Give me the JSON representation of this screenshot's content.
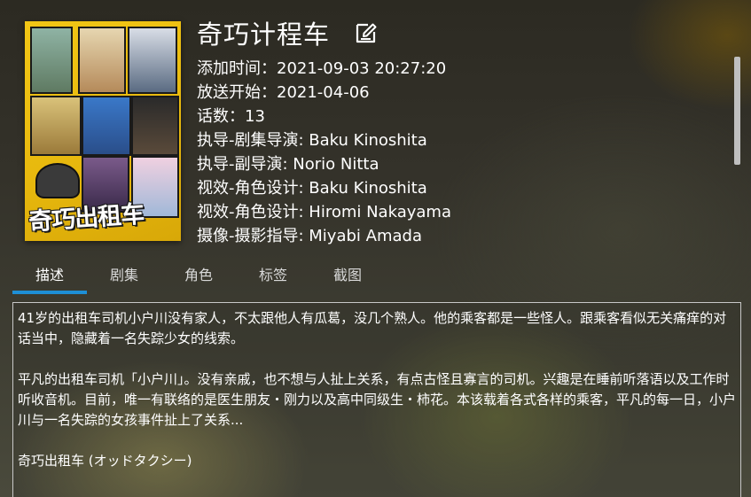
{
  "poster": {
    "logo_text": "奇巧出租车"
  },
  "header": {
    "title": "奇巧计程车",
    "edit_icon": "edit-icon"
  },
  "details": [
    "添加时间：2021-09-03 20:27:20",
    "放送开始：2021-04-06",
    "话数：13",
    "执导-剧集导演: Baku Kinoshita",
    "执导-副导演: Norio Nitta",
    "视效-角色设计: Baku Kinoshita",
    "视效-角色设计: Hiromi Nakayama",
    "摄像-摄影指导: Miyabi Amada"
  ],
  "tabs": [
    {
      "label": "描述",
      "active": true
    },
    {
      "label": "剧集",
      "active": false
    },
    {
      "label": "角色",
      "active": false
    },
    {
      "label": "标签",
      "active": false
    },
    {
      "label": "截图",
      "active": false
    }
  ],
  "description": [
    "41岁的出租车司机小户川没有家人，不太跟他人有瓜葛，没几个熟人。他的乘客都是一些怪人。跟乘客看似无关痛痒的对话当中，隐藏着一名失踪少女的线索。",
    "平凡的出租车司机「小户川」。没有亲戚，也不想与人扯上关系，有点古怪且寡言的司机。兴趣是在睡前听落语以及工作时听收音机。目前，唯一有联络的是医生朋友・刚力以及高中同级生・柿花。本该载着各式各样的乘客，平凡的每一日，小户川与一名失踪的女孩事件扯上了关系...",
    "奇巧出租车 (オッドタクシー)"
  ],
  "colors": {
    "accent": "#1e8fd6",
    "text": "#ffffff",
    "scrollbar": "#bfbfbf"
  }
}
